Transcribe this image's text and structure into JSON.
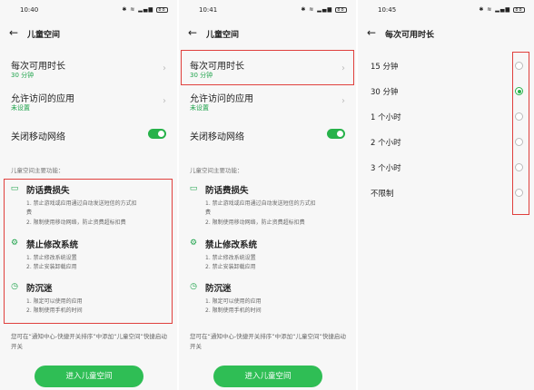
{
  "panels": [
    {
      "time": "10:40",
      "battery": "88",
      "title": "儿童空间",
      "row1": {
        "label": "每次可用时长",
        "sub": "30 分钟"
      },
      "row2": {
        "label": "允许访问的应用",
        "sub": "未设置"
      },
      "row3": {
        "label": "关闭移动网络",
        "toggle": "on"
      },
      "section": "儿童空间主要功能：",
      "features": [
        {
          "title": "防话费损失",
          "icon": "chat-bubble-icon",
          "lines": [
            "1. 禁止游戏或应用通过自动发送短信的方式扣",
            "费",
            "2. 限制使用移动网络，防止资费超标扣费"
          ]
        },
        {
          "title": "禁止修改系统",
          "icon": "gear-icon",
          "lines": [
            "1. 禁止修改系统设置",
            "2. 禁止安装卸载应用"
          ]
        },
        {
          "title": "防沉迷",
          "icon": "clock-icon",
          "lines": [
            "1. 限定可以使用的应用",
            "2. 限制使用手机的时间"
          ]
        }
      ],
      "tip": "您可在“通知中心-快捷开关排序”中添加“儿童空间”快捷启动开关",
      "button": "进入儿童空间"
    },
    {
      "time": "10:41",
      "battery": "88",
      "title": "儿童空间",
      "row1": {
        "label": "每次可用时长",
        "sub": "30 分钟"
      },
      "row2": {
        "label": "允许访问的应用",
        "sub": "未设置"
      },
      "row3": {
        "label": "关闭移动网络",
        "toggle": "on"
      },
      "section": "儿童空间主要功能：",
      "features": [
        {
          "title": "防话费损失",
          "icon": "chat-bubble-icon",
          "lines": [
            "1. 禁止游戏或应用通过自动发送短信的方式扣",
            "费",
            "2. 限制使用移动网络，防止资费超标扣费"
          ]
        },
        {
          "title": "禁止修改系统",
          "icon": "gear-icon",
          "lines": [
            "1. 禁止修改系统设置",
            "2. 禁止安装卸载应用"
          ]
        },
        {
          "title": "防沉迷",
          "icon": "clock-icon",
          "lines": [
            "1. 限定可以使用的应用",
            "2. 限制使用手机的时间"
          ]
        }
      ],
      "tip": "您可在“通知中心-快捷开关排序”中添加“儿童空间”快捷启动开关",
      "button": "进入儿童空间"
    },
    {
      "time": "10:45",
      "battery": "88",
      "title": "每次可用时长",
      "options": [
        {
          "label": "15 分钟",
          "selected": false
        },
        {
          "label": "30 分钟",
          "selected": true
        },
        {
          "label": "1 个小时",
          "selected": false
        },
        {
          "label": "2 个小时",
          "selected": false
        },
        {
          "label": "3 个小时",
          "selected": false
        },
        {
          "label": "不限制",
          "selected": false
        }
      ]
    }
  ],
  "colors": {
    "accent": "#27b24a",
    "highlight": "#e0403d"
  }
}
